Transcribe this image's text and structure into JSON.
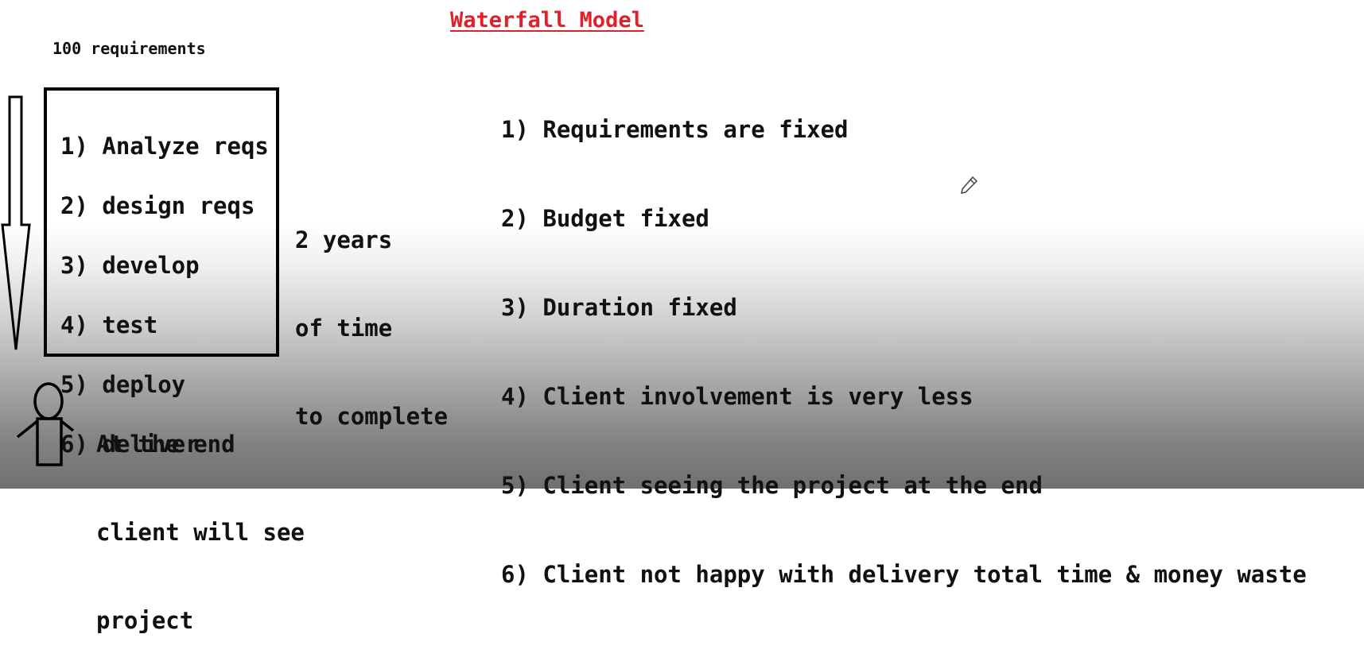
{
  "title": "Waterfall Model",
  "requirements_count": "100 requirements",
  "phases": [
    "1) Analyze reqs",
    "2) design reqs",
    "3) develop",
    "4) test",
    "5) deploy",
    "6) deliver"
  ],
  "duration_lines": [
    "2 years",
    "of time",
    "to complete"
  ],
  "end_note_lines": [
    "At the end",
    "client will see",
    "project"
  ],
  "characteristics": [
    "1) Requirements are fixed",
    "2) Budget fixed",
    "3) Duration fixed",
    "4) Client involvement is very less",
    "5) Client seeing the project at the end",
    "6) Client not happy with delivery total time & money waste"
  ],
  "icons": {
    "flow_arrow": "down-arrow-icon",
    "client_figure": "person-icon",
    "pen_cursor": "pencil-icon"
  }
}
